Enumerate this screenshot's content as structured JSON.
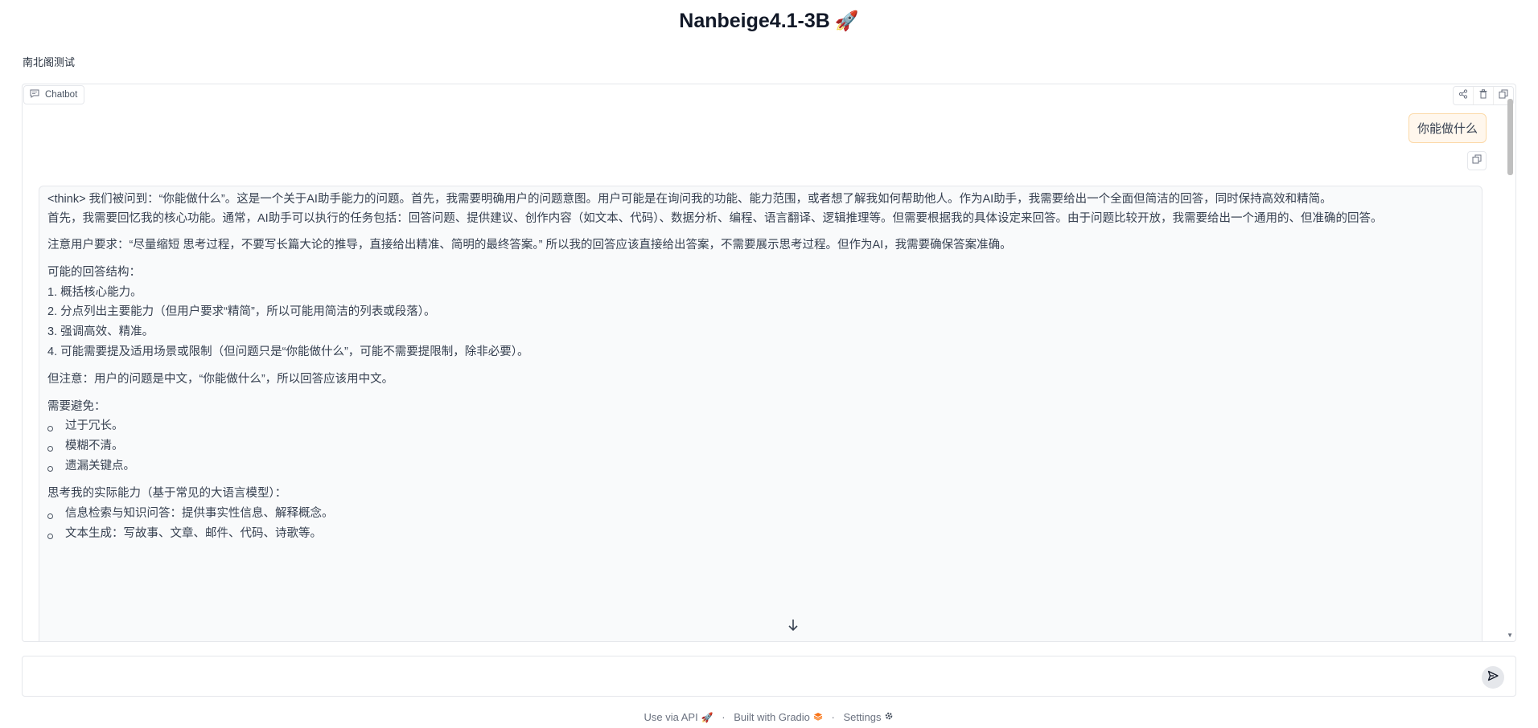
{
  "app": {
    "title": "Nanbeige4.1-3B",
    "title_emoji": "🚀",
    "subtitle": "南北阁测试"
  },
  "chatbot": {
    "label": "Chatbot",
    "user_message": "你能做什么",
    "bot_message": {
      "intro": [
        "<think> 我们被问到：“你能做什么”。这是一个关于AI助手能力的问题。首先，我需要明确用户的问题意图。用户可能是在询问我的功能、能力范围，或者想了解我如何帮助他人。作为AI助手，我需要给出一个全面但简洁的回答，同时保持高效和精简。",
        "首先，我需要回忆我的核心功能。通常，AI助手可以执行的任务包括：回答问题、提供建议、创作内容（如文本、代码）、数据分析、编程、语言翻译、逻辑推理等。但需要根据我的具体设定来回答。由于问题比较开放，我需要给出一个通用的、但准确的回答。"
      ],
      "note": "注意用户要求：“尽量缩短 思考过程，不要写长篇大论的推导，直接给出精准、简明的最终答案。” 所以我的回答应该直接给出答案，不需要展示思考过程。但作为AI，我需要确保答案准确。",
      "structure_heading": "可能的回答结构：",
      "structure_items": [
        "1. 概括核心能力。",
        "2. 分点列出主要能力（但用户要求“精简”，所以可能用简洁的列表或段落）。",
        "3. 强调高效、精准。",
        "4. 可能需要提及适用场景或限制（但问题只是“你能做什么”，可能不需要提限制，除非必要）。"
      ],
      "language_note": "但注意：用户的问题是中文，“你能做什么”，所以回答应该用中文。",
      "avoid_heading": "需要避免：",
      "avoid_items": [
        "过于冗长。",
        "模糊不清。",
        "遗漏关键点。"
      ],
      "abilities_heading": "思考我的实际能力（基于常见的大语言模型）：",
      "abilities_items": [
        "信息检索与知识问答：提供事实性信息、解释概念。",
        "文本生成：写故事、文章、邮件、代码、诗歌等。"
      ]
    }
  },
  "input": {
    "placeholder": "",
    "value": ""
  },
  "footer": {
    "api": "Use via API",
    "built": "Built with Gradio",
    "settings": "Settings"
  },
  "icons": {
    "chat": "chat-bubble-icon",
    "share": "share-icon",
    "trash": "trash-icon",
    "copy": "copy-icon",
    "send": "send-icon",
    "arrow_down": "arrow-down-icon",
    "rocket": "rocket-icon",
    "gradio": "gradio-logo-icon",
    "gear": "gear-icon"
  },
  "colors": {
    "user_bubble_bg": "#fff7ed",
    "user_bubble_border": "#fcd9a8",
    "bot_bg": "#f9fafb"
  }
}
